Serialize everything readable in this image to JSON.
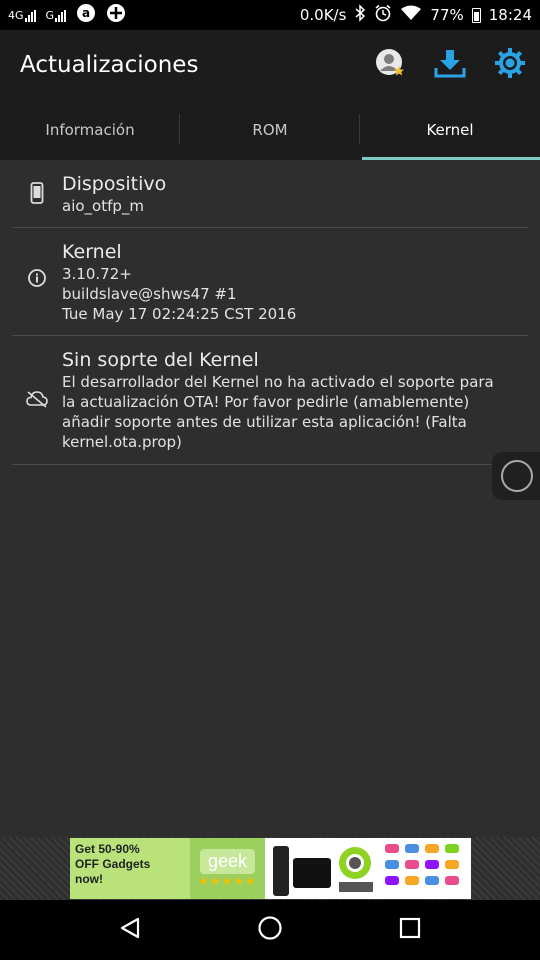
{
  "status_bar": {
    "network1": "4G",
    "network2": "G",
    "speed": "0.0K/s",
    "battery": "77%",
    "time": "18:24",
    "icons": [
      "amazon-icon",
      "notification-icon",
      "bluetooth-icon",
      "alarm-icon",
      "wifi-icon",
      "battery-icon"
    ]
  },
  "app_bar": {
    "title": "Actualizaciones",
    "actions": [
      "account-icon",
      "download-icon",
      "settings-icon"
    ]
  },
  "tabs": [
    {
      "label": "Información",
      "active": false
    },
    {
      "label": "ROM",
      "active": false
    },
    {
      "label": "Kernel",
      "active": true
    }
  ],
  "items": [
    {
      "icon": "phone-icon",
      "title": "Dispositivo",
      "lines": [
        "aio_otfp_m"
      ]
    },
    {
      "icon": "info-icon",
      "title": "Kernel",
      "lines": [
        "3.10.72+",
        "buildslave@shws47 #1",
        "Tue May 17 02:24:25 CST 2016"
      ]
    },
    {
      "icon": "cloud-off-icon",
      "title": "Sin soprte del Kernel",
      "lines": [
        "El desarrollador del Kernel no ha activado el soporte para",
        "la actualización OTA! Por favor pedirle (amablemente)",
        "añadir soporte antes de utilizar esta aplicación! (Falta",
        "kernel.ota.prop)"
      ]
    }
  ],
  "ad": {
    "text_lines": [
      "Get 50-90%",
      "OFF Gadgets",
      "now!"
    ],
    "brand": "geek",
    "stars": "★★★★★",
    "accent": "#b9e37a"
  },
  "colors": {
    "background": "#2e2e2e",
    "appbar": "#1c1c1c",
    "tab_indicator": "#7fc9c2",
    "action_blue": "#2aa3e6"
  }
}
